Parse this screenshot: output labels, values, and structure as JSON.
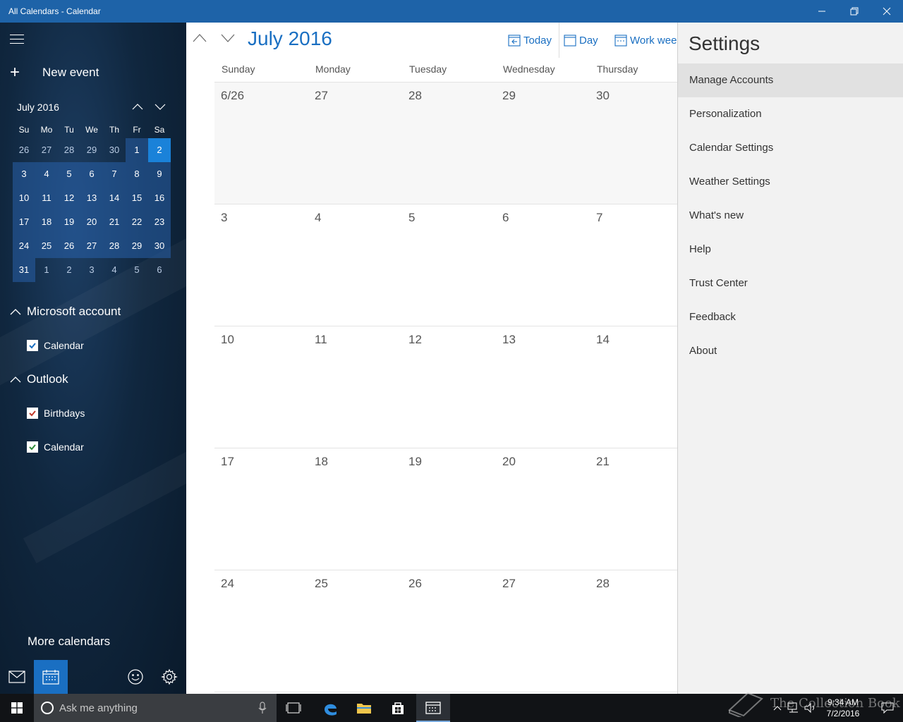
{
  "window": {
    "title": "All Calendars - Calendar",
    "controls": [
      "minimize-icon",
      "restore-icon",
      "close-icon"
    ]
  },
  "sidebar": {
    "new_event_label": "New event",
    "mini_calendar": {
      "month_label": "July 2016",
      "weekdays": [
        "Su",
        "Mo",
        "Tu",
        "We",
        "Th",
        "Fr",
        "Sa"
      ],
      "weeks": [
        [
          "26",
          "27",
          "28",
          "29",
          "30",
          "1",
          "2"
        ],
        [
          "3",
          "4",
          "5",
          "6",
          "7",
          "8",
          "9"
        ],
        [
          "10",
          "11",
          "12",
          "13",
          "14",
          "15",
          "16"
        ],
        [
          "17",
          "18",
          "19",
          "20",
          "21",
          "22",
          "23"
        ],
        [
          "24",
          "25",
          "26",
          "27",
          "28",
          "29",
          "30"
        ],
        [
          "31",
          "1",
          "2",
          "3",
          "4",
          "5",
          "6"
        ]
      ],
      "selected_day": "2"
    },
    "accounts": [
      {
        "name": "Microsoft account",
        "calendars": [
          {
            "label": "Calendar",
            "checked": true,
            "color": "#1a6fc2"
          }
        ]
      },
      {
        "name": "Outlook",
        "calendars": [
          {
            "label": "Birthdays",
            "checked": true,
            "color": "#c0392b"
          },
          {
            "label": "Calendar",
            "checked": true,
            "color": "#2e8b3a"
          }
        ]
      }
    ],
    "more_calendars_label": "More calendars",
    "bottom_icons": [
      "mail-icon",
      "calendar-icon",
      "smiley-icon",
      "gear-icon"
    ]
  },
  "main": {
    "month_title": "July 2016",
    "toolbar": {
      "today_label": "Today",
      "day_label": "Day",
      "work_week_label": "Work week"
    },
    "weekday_headers": [
      "Sunday",
      "Monday",
      "Tuesday",
      "Wednesday",
      "Thursday"
    ],
    "weeks": [
      [
        "6/26",
        "27",
        "28",
        "29",
        "30"
      ],
      [
        "3",
        "4",
        "5",
        "6",
        "7"
      ],
      [
        "10",
        "11",
        "12",
        "13",
        "14"
      ],
      [
        "17",
        "18",
        "19",
        "20",
        "21"
      ],
      [
        "24",
        "25",
        "26",
        "27",
        "28"
      ]
    ]
  },
  "settings": {
    "title": "Settings",
    "items": [
      "Manage Accounts",
      "Personalization",
      "Calendar Settings",
      "Weather Settings",
      "What's new",
      "Help",
      "Trust Center",
      "Feedback",
      "About"
    ],
    "highlighted_item": "Manage Accounts"
  },
  "taskbar": {
    "search_placeholder": "Ask me anything",
    "time": "9:34 AM",
    "date": "7/2/2016",
    "watermark": "The Collection Book",
    "accent_color": "#1e63a8"
  }
}
